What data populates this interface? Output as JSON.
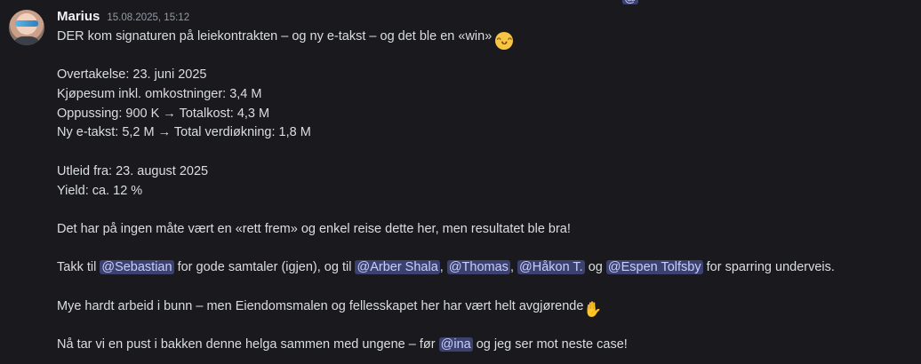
{
  "message": {
    "author": "Marius",
    "timestamp": "15.08.2025, 15:12",
    "line1_text": "DER kom signaturen på leiekontrakten – og ny e-takst – og det ble en «win»",
    "emoji_grin": "😁",
    "facts": [
      "Overtakelse: 23. juni 2025",
      "Kjøpesum inkl. omkostninger: 3,4 M",
      "Oppussing: 900 K → Totalkost: 4,3 M",
      "Ny e-takst: 5,2 M → Total verdiøkning: 1,8 M"
    ],
    "rental": [
      "Utleid fra: 23. august 2025",
      "Yield: ca. 12 %"
    ],
    "paragraph": "Det har på ingen måte vært en «rett frem»  og enkel reise dette her, men resultatet ble bra!",
    "thanks": {
      "prefix": "Takk til ",
      "mention1": "@Sebastian",
      "text1": " for gode samtaler (igjen), og til ",
      "mention2": "@Arber Shala",
      "sep1": ", ",
      "mention3": "@Thomas",
      "sep2": ", ",
      "mention4": "@Håkon T.",
      "sep3": "  og ",
      "mention5": "@Espen Tolfsby",
      "suffix": " for sparring underveis."
    },
    "hardwork": "Mye hardt arbeid i bunn – men Eiendomsmalen og fellesskapet her har vært helt avgjørende",
    "emoji_hands": "🙌",
    "closing": {
      "prefix": "Nå tar vi en pust i bakken denne helga sammen med ungene – før ",
      "mention": "@ina",
      "suffix": " og jeg ser mot neste case!"
    }
  },
  "top_strip_mention": "@"
}
